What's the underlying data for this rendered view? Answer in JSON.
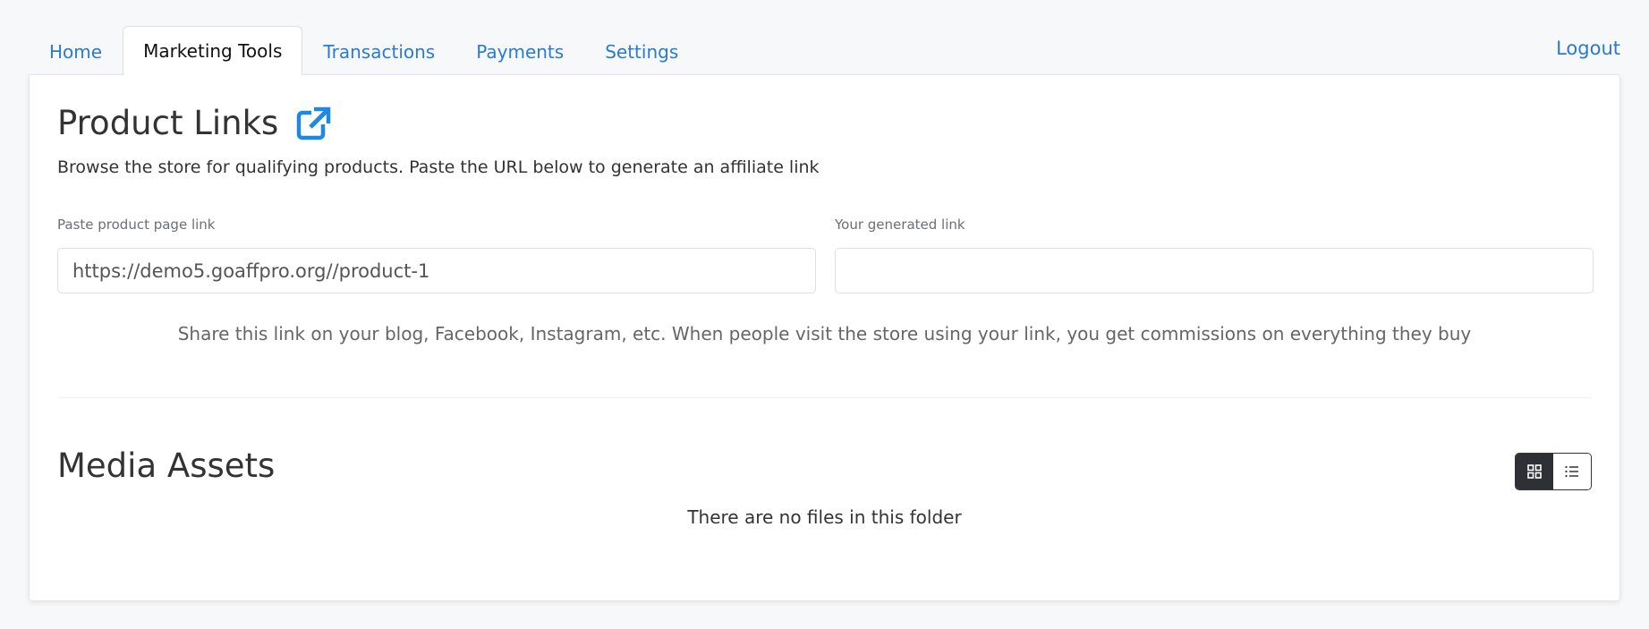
{
  "nav": {
    "tabs": [
      {
        "label": "Home"
      },
      {
        "label": "Marketing Tools"
      },
      {
        "label": "Transactions"
      },
      {
        "label": "Payments"
      },
      {
        "label": "Settings"
      }
    ],
    "active_tab": "Marketing Tools",
    "logout_label": "Logout"
  },
  "product_links": {
    "title": "Product Links",
    "description": "Browse the store for qualifying products. Paste the URL below to generate an affiliate link",
    "source_label": "Paste product page link",
    "source_value": "https://demo5.goaffpro.org//product-1",
    "generated_label": "Your generated link",
    "generated_value": "",
    "hint": "Share this link on your blog, Facebook, Instagram, etc. When people visit the store using your link, you get commissions on everything they buy",
    "icon": "external-link-icon"
  },
  "media_assets": {
    "title": "Media Assets",
    "empty_message": "There are no files in this folder",
    "view_modes": [
      "grid",
      "list"
    ],
    "active_view": "grid"
  },
  "colors": {
    "accent": "#2a7ad4",
    "icon_blue": "#1e88e5",
    "toggle_active": "#2d3035"
  }
}
